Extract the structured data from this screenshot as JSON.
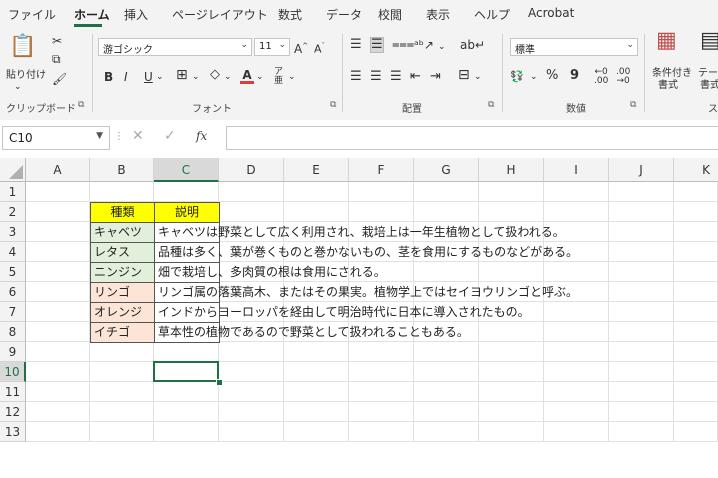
{
  "tabs": [
    {
      "label": "ファイル"
    },
    {
      "label": "ホーム"
    },
    {
      "label": "挿入"
    },
    {
      "label": "ページレイアウト"
    },
    {
      "label": "数式"
    },
    {
      "label": "データ"
    },
    {
      "label": "校閲"
    },
    {
      "label": "表示"
    },
    {
      "label": "ヘルプ"
    },
    {
      "label": "Acrobat"
    }
  ],
  "ribbon": {
    "clipboard": {
      "paste_label": "貼り付け",
      "group_label": "クリップボード"
    },
    "font": {
      "font_name": "游ゴシック",
      "font_size": "11",
      "bold": "B",
      "italic": "I",
      "underline": "U",
      "grow": "A^",
      "shrink": "Aˇ",
      "font_color_letter": "A",
      "group_label": "フォント",
      "font_color": "#e03a3a"
    },
    "alignment": {
      "group_label": "配置"
    },
    "number": {
      "format": "標準",
      "percent": "%",
      "comma": "9",
      "group_label": "数値"
    },
    "styles": {
      "conditional_label_1": "条件付き",
      "conditional_label_2": "書式",
      "table_label_1": "テーブル",
      "table_label_2": "書式",
      "group_label_cut": "ス"
    }
  },
  "formula_bar": {
    "name_box": "C10",
    "fx": "fx",
    "value": ""
  },
  "grid": {
    "columns": [
      "A",
      "B",
      "C",
      "D",
      "E",
      "F",
      "G",
      "H",
      "I",
      "J",
      "K"
    ],
    "rows": [
      "1",
      "2",
      "3",
      "4",
      "5",
      "6",
      "7",
      "8",
      "9",
      "10",
      "11",
      "12",
      "13"
    ],
    "selected_cell": "C10",
    "header": {
      "b": "種類",
      "c": "説明",
      "fill": "#ffff00"
    },
    "data": [
      {
        "kind": "キャベツ",
        "desc": "キャベツは野菜として広く利用され、栽培上は一年生植物として扱われる。",
        "fill": "#e2efda"
      },
      {
        "kind": "レタス",
        "desc": "品種は多く、葉が巻くものと巻かないもの、茎を食用にするものなどがある。",
        "fill": "#e2efda"
      },
      {
        "kind": "ニンジン",
        "desc": "畑で栽培し、多肉質の根は食用にされる。",
        "fill": "#e2efda"
      },
      {
        "kind": "リンゴ",
        "desc": "リンゴ属の落葉高木、またはその果実。植物学上ではセイヨウリンゴと呼ぶ。",
        "fill": "#fce4d6"
      },
      {
        "kind": "オレンジ",
        "desc": "インドからヨーロッパを経由して明治時代に日本に導入されたもの。",
        "fill": "#fce4d6"
      },
      {
        "kind": "イチゴ",
        "desc": "草本性の植物であるので野菜として扱われることもある。",
        "fill": "#fce4d6"
      }
    ],
    "accent": "#1e7145"
  }
}
